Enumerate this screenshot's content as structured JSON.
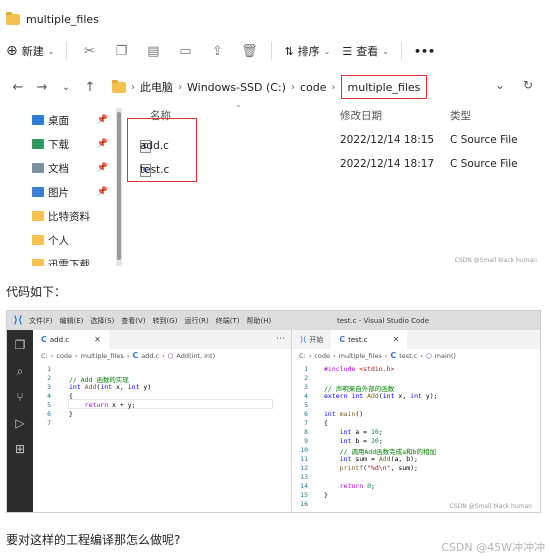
{
  "explorer": {
    "window_title": "multiple_files",
    "toolbar": {
      "new_label": "新建",
      "sort_label": "排序",
      "view_label": "查看",
      "more_label": "•••"
    },
    "nav": {
      "back": "←",
      "forward": "→",
      "recent": "⌄",
      "up": "↑"
    },
    "breadcrumb": [
      "此电脑",
      "Windows-SSD (C:)",
      "code",
      "multiple_files"
    ],
    "sidebar": [
      {
        "label": "桌面",
        "pinned": true,
        "icon": "desktop-icon"
      },
      {
        "label": "下载",
        "pinned": true,
        "icon": "download-icon"
      },
      {
        "label": "文档",
        "pinned": true,
        "icon": "document-icon"
      },
      {
        "label": "图片",
        "pinned": true,
        "icon": "picture-icon"
      },
      {
        "label": "比特资料",
        "pinned": false,
        "icon": "folder-icon"
      },
      {
        "label": "个人",
        "pinned": false,
        "icon": "folder-icon"
      },
      {
        "label": "迅雷下载",
        "pinned": false,
        "icon": "folder-icon"
      }
    ],
    "columns": {
      "name": "名称",
      "modified": "修改日期",
      "type": "类型"
    },
    "files": [
      {
        "name": "add.c",
        "modified": "2022/12/14 18:15",
        "type": "C Source File"
      },
      {
        "name": "test.c",
        "modified": "2022/12/14 18:17",
        "type": "C Source File"
      }
    ],
    "watermark": "CSDN @Small black human",
    "highlight_color": "#e03131"
  },
  "caption": "代码如下：",
  "vscode": {
    "window_title": "test.c - Visual Studio Code",
    "menu": [
      "文件(F)",
      "编辑(E)",
      "选择(S)",
      "查看(V)",
      "转到(G)",
      "运行(R)",
      "终端(T)",
      "帮助(H)"
    ],
    "left": {
      "tab": "add.c",
      "breadcrumb": [
        "C:",
        "code",
        "multiple_files",
        "add.c",
        "Add(int, int)"
      ],
      "lines": [
        "1",
        "2",
        "3",
        "4",
        "5",
        "6",
        "7"
      ]
    },
    "right": {
      "tab_start": "开始",
      "tab": "test.c",
      "breadcrumb": [
        "C:",
        "code",
        "multiple_files",
        "test.c",
        "main()"
      ],
      "lines": [
        "1",
        "2",
        "3",
        "4",
        "5",
        "6",
        "7",
        "8",
        "9",
        "10",
        "11",
        "12",
        "13",
        "14",
        "15",
        "16"
      ]
    },
    "watermark": "CSDN @Small black human"
  },
  "question": "要对这样的工程编译那怎么做呢?",
  "page_watermark": "CSDN @45W冲冲冲"
}
